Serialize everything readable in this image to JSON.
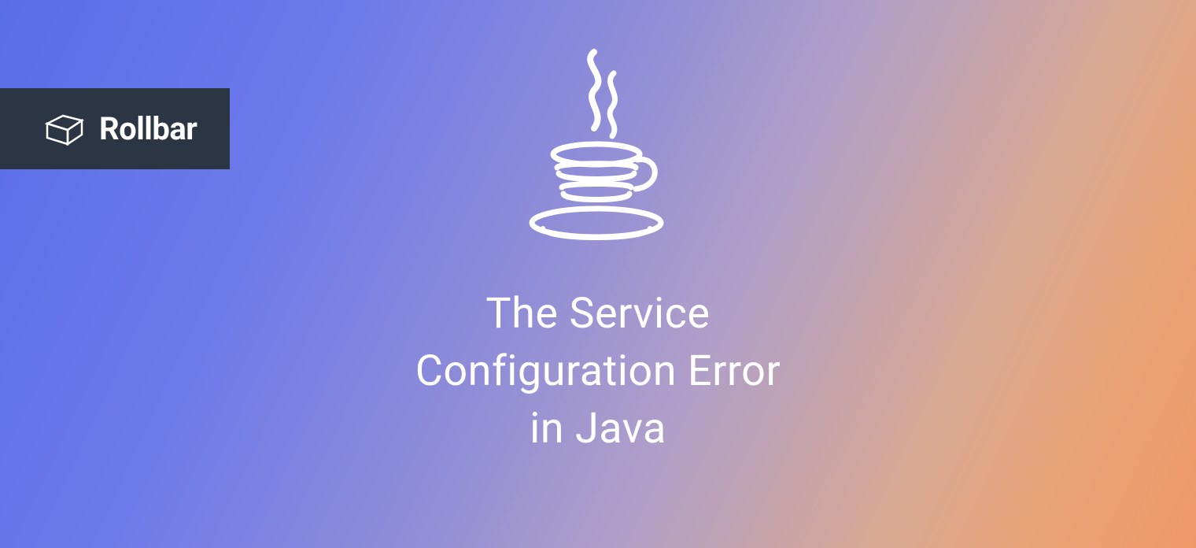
{
  "badge": {
    "brand_name": "Rollbar"
  },
  "title": {
    "line1": "The Service",
    "line2": "Configuration Error",
    "line3": "in Java"
  }
}
